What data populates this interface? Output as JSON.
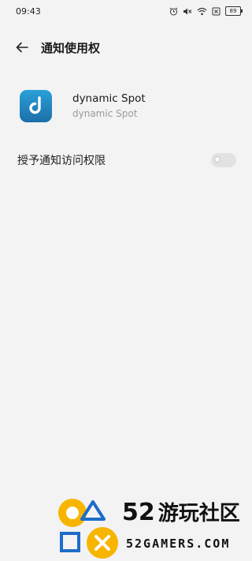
{
  "status_bar": {
    "time": "09:43",
    "battery": "89",
    "icons": [
      "alarm-icon",
      "mute-icon",
      "wifi-icon",
      "sim-off-icon",
      "battery-icon"
    ]
  },
  "header": {
    "title": "通知使用权"
  },
  "app": {
    "name": "dynamic Spot",
    "subtitle": "dynamic Spot",
    "icon_letter": "d"
  },
  "setting": {
    "label": "授予通知访问权限",
    "enabled": false
  },
  "watermark": {
    "line1_num": "52",
    "line1_cn": "游玩社区",
    "line2": "52GAMERS.COM"
  },
  "colors": {
    "background": "#f3f3f3",
    "app_icon": "#1f86c2",
    "watermark_yellow": "#f7b500",
    "watermark_blue": "#1e6cc8"
  }
}
